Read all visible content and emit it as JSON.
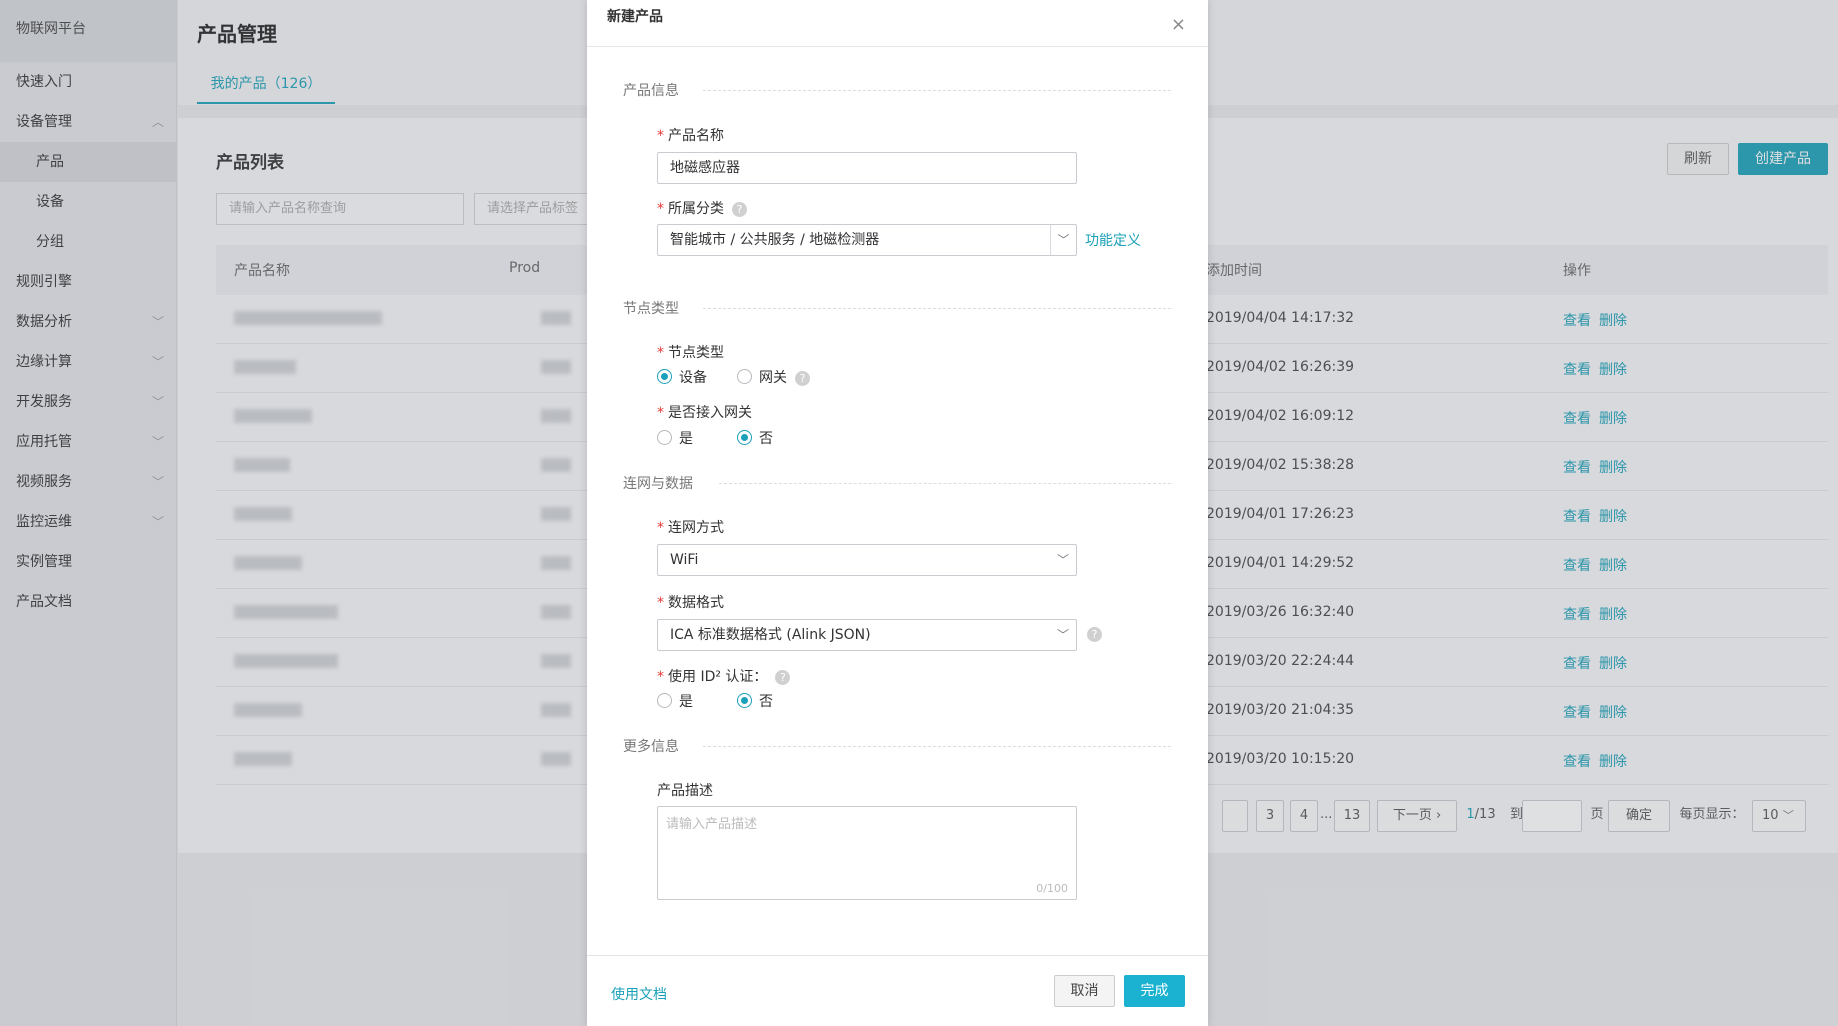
{
  "sidebar": {
    "brand": "物联网平台",
    "items": [
      {
        "label": "快速入门",
        "expand": ""
      },
      {
        "label": "设备管理",
        "expand": "︿"
      },
      {
        "label": "产品",
        "expand": ""
      },
      {
        "label": "设备",
        "expand": ""
      },
      {
        "label": "分组",
        "expand": ""
      },
      {
        "label": "规则引擎",
        "expand": ""
      },
      {
        "label": "数据分析",
        "expand": "﹀"
      },
      {
        "label": "边缘计算",
        "expand": "﹀"
      },
      {
        "label": "开发服务",
        "expand": "﹀"
      },
      {
        "label": "应用托管",
        "expand": "﹀"
      },
      {
        "label": "视频服务",
        "expand": "﹀"
      },
      {
        "label": "监控运维",
        "expand": "﹀"
      },
      {
        "label": "实例管理",
        "expand": ""
      },
      {
        "label": "产品文档",
        "expand": ""
      }
    ]
  },
  "page": {
    "title": "产品管理",
    "tab": "我的产品（126）",
    "list_title": "产品列表",
    "refresh": "刷新",
    "create": "创建产品",
    "search_placeholder": "请输入产品名称查询",
    "tag_placeholder": "请选择产品标签",
    "columns": {
      "name": "产品名称",
      "product": "Prod",
      "time": "添加时间",
      "action": "操作"
    },
    "rows": [
      {
        "time": "2019/04/04 14:17:32",
        "view": "查看",
        "delete": "删除"
      },
      {
        "time": "2019/04/02 16:26:39",
        "view": "查看",
        "delete": "删除"
      },
      {
        "time": "2019/04/02 16:09:12",
        "view": "查看",
        "delete": "删除"
      },
      {
        "time": "2019/04/02 15:38:28",
        "view": "查看",
        "delete": "删除"
      },
      {
        "time": "2019/04/01 17:26:23",
        "view": "查看",
        "delete": "删除"
      },
      {
        "time": "2019/04/01 14:29:52",
        "view": "查看",
        "delete": "删除"
      },
      {
        "time": "2019/03/26 16:32:40",
        "view": "查看",
        "delete": "删除"
      },
      {
        "time": "2019/03/20 22:24:44",
        "view": "查看",
        "delete": "删除"
      },
      {
        "time": "2019/03/20 21:04:35",
        "view": "查看",
        "delete": "删除"
      },
      {
        "time": "2019/03/20 10:15:20",
        "view": "查看",
        "delete": "删除"
      }
    ],
    "pager": {
      "p3": "3",
      "p4": "4",
      "ellipsis": "...",
      "p13": "13",
      "next": "下一页 ›",
      "current": "1",
      "total": "/13",
      "goto": "到第",
      "page_unit": "页",
      "confirm": "确定",
      "per_page_label": "每页显示：",
      "per_page": "10"
    }
  },
  "modal": {
    "title": "新建产品",
    "close": "×",
    "sections": {
      "info": "产品信息",
      "node": "节点类型",
      "network": "连网与数据",
      "more": "更多信息"
    },
    "product_name": {
      "label": "产品名称",
      "value": "地磁感应器"
    },
    "category": {
      "label": "所属分类",
      "value": "智能城市 / 公共服务 / 地磁检测器",
      "link": "功能定义"
    },
    "node_type": {
      "label": "节点类型",
      "opt_device": "设备",
      "opt_gateway": "网关"
    },
    "gateway_access": {
      "label": "是否接入网关",
      "opt_yes": "是",
      "opt_no": "否"
    },
    "network_mode": {
      "label": "连网方式",
      "value": "WiFi"
    },
    "data_format": {
      "label": "数据格式",
      "value": "ICA 标准数据格式 (Alink JSON)"
    },
    "id2": {
      "label": "使用 ID² 认证：",
      "opt_yes": "是",
      "opt_no": "否"
    },
    "description": {
      "label": "产品描述",
      "placeholder": "请输入产品描述",
      "counter": "0/100"
    },
    "help_glyph": "?",
    "arrow_glyph": "﹀",
    "footer": {
      "docs": "使用文档",
      "cancel": "取消",
      "done": "完成"
    }
  }
}
